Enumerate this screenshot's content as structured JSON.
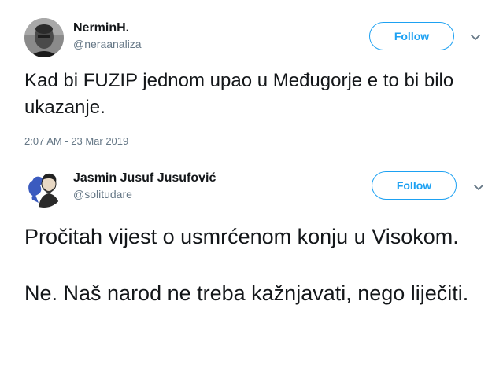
{
  "tweets": [
    {
      "display_name": "NerminH.",
      "handle": "@neraanaliza",
      "follow_label": "Follow",
      "text": "Kad bi FUZIP jednom upao u Međugorje e to bi bilo ukazanje.",
      "timestamp": "2:07 AM - 23 Mar 2019"
    },
    {
      "display_name": "Jasmin Jusuf Jusufović",
      "handle": "@solitudare",
      "follow_label": "Follow",
      "text": "Pročitah vijest o usmrćenom konju u Visokom.\n\nNe. Naš narod ne treba kažnjavati, nego liječiti."
    }
  ],
  "colors": {
    "accent": "#1da1f2",
    "secondary_text": "#657786",
    "primary_text": "#14171a"
  },
  "icons": {
    "more": "chevron-down-icon"
  }
}
